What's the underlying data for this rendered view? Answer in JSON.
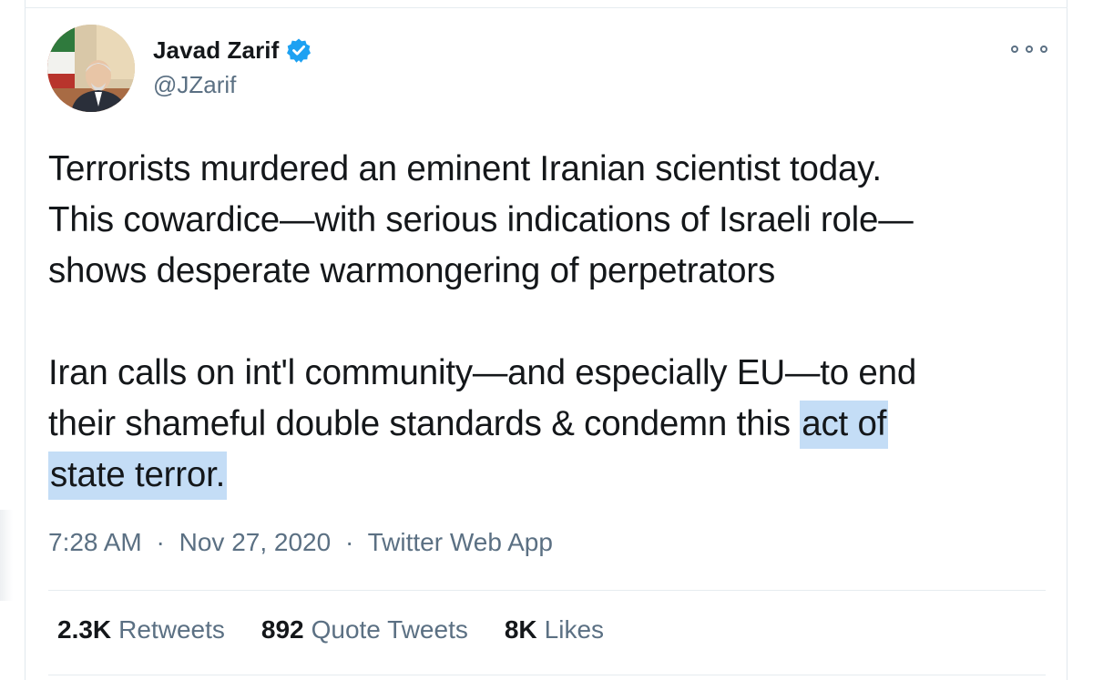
{
  "tweet": {
    "author": {
      "display_name": "Javad Zarif",
      "handle": "@JZarif",
      "verified": true,
      "avatar_icon": "profile-photo"
    },
    "menu_icon": "more-options-icon",
    "text": {
      "line1": "Terrorists murdered an eminent Iranian scientist today.",
      "line2": "This cowardice—with serious indications of Israeli role—",
      "line3": "shows desperate warmongering of perpetrators",
      "line4": "Iran calls on int'l community—and especially EU—to end",
      "line5_plain": "their shameful double standards & condemn this ",
      "line5_highlight": "act of",
      "line6_highlight": "state terror."
    },
    "meta": {
      "time": "7:28 AM",
      "separator": "·",
      "date": "Nov 27, 2020",
      "source": "Twitter Web App"
    },
    "stats": {
      "retweets_count": "2.3K",
      "retweets_label": "Retweets",
      "quote_count": "892",
      "quote_label": "Quote Tweets",
      "likes_count": "8K",
      "likes_label": "Likes"
    }
  },
  "colors": {
    "text_primary": "#14171a",
    "text_secondary": "#5b7083",
    "verified_blue": "#1da1f2",
    "selection_highlight": "#c4ddf6",
    "divider": "#e6ecf0"
  }
}
